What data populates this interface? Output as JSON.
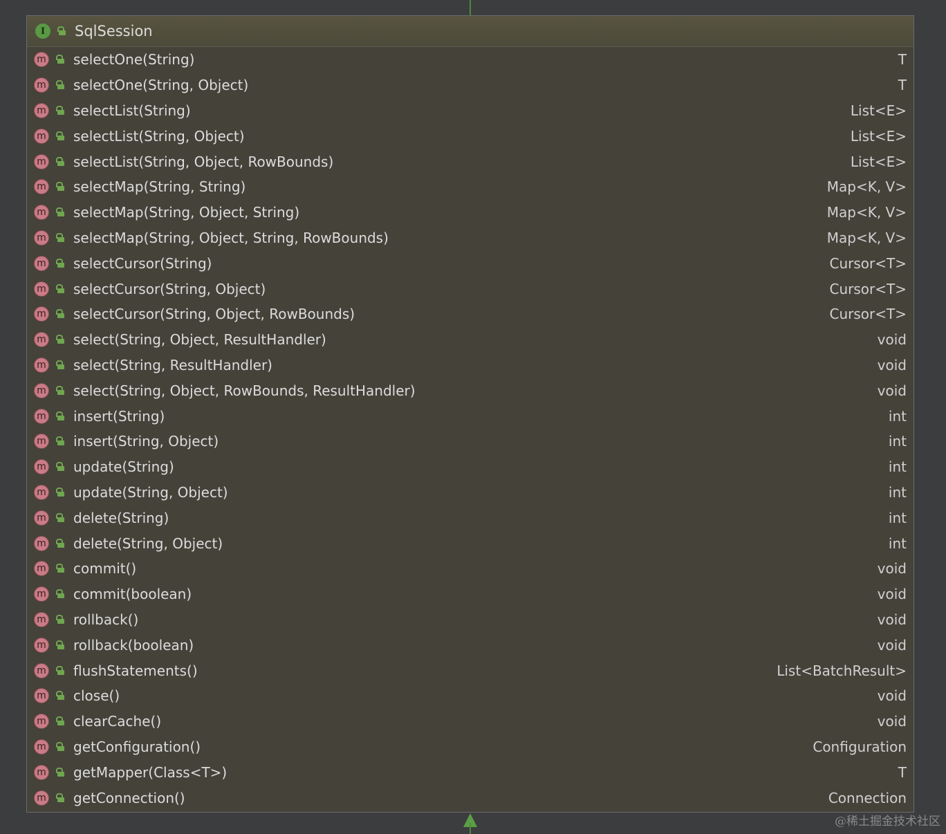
{
  "class": {
    "icon_letter": "I",
    "name": "SqlSession",
    "methods": [
      {
        "name": "selectOne(String)",
        "returns": "T"
      },
      {
        "name": "selectOne(String, Object)",
        "returns": "T"
      },
      {
        "name": "selectList(String)",
        "returns": "List<E>"
      },
      {
        "name": "selectList(String, Object)",
        "returns": "List<E>"
      },
      {
        "name": "selectList(String, Object, RowBounds)",
        "returns": "List<E>"
      },
      {
        "name": "selectMap(String, String)",
        "returns": "Map<K, V>"
      },
      {
        "name": "selectMap(String, Object, String)",
        "returns": "Map<K, V>"
      },
      {
        "name": "selectMap(String, Object, String, RowBounds)",
        "returns": "Map<K, V>"
      },
      {
        "name": "selectCursor(String)",
        "returns": "Cursor<T>"
      },
      {
        "name": "selectCursor(String, Object)",
        "returns": "Cursor<T>"
      },
      {
        "name": "selectCursor(String, Object, RowBounds)",
        "returns": "Cursor<T>"
      },
      {
        "name": "select(String, Object, ResultHandler)",
        "returns": "void"
      },
      {
        "name": "select(String, ResultHandler)",
        "returns": "void"
      },
      {
        "name": "select(String, Object, RowBounds, ResultHandler)",
        "returns": "void"
      },
      {
        "name": "insert(String)",
        "returns": "int"
      },
      {
        "name": "insert(String, Object)",
        "returns": "int"
      },
      {
        "name": "update(String)",
        "returns": "int"
      },
      {
        "name": "update(String, Object)",
        "returns": "int"
      },
      {
        "name": "delete(String)",
        "returns": "int"
      },
      {
        "name": "delete(String, Object)",
        "returns": "int"
      },
      {
        "name": "commit()",
        "returns": "void"
      },
      {
        "name": "commit(boolean)",
        "returns": "void"
      },
      {
        "name": "rollback()",
        "returns": "void"
      },
      {
        "name": "rollback(boolean)",
        "returns": "void"
      },
      {
        "name": "flushStatements()",
        "returns": "List<BatchResult>"
      },
      {
        "name": "close()",
        "returns": "void"
      },
      {
        "name": "clearCache()",
        "returns": "void"
      },
      {
        "name": "getConfiguration()",
        "returns": "Configuration"
      },
      {
        "name": "getMapper(Class<T>)",
        "returns": "T"
      },
      {
        "name": "getConnection()",
        "returns": "Connection"
      }
    ]
  },
  "method_icon_letter": "m",
  "watermark": "@稀土掘金技术社区",
  "colors": {
    "background": "#3b3d3f",
    "box_fill": "#45423a",
    "interface_icon": "#5a9a45",
    "method_icon": "#c97c86",
    "public_lock": "#6fa64f",
    "connector": "#5b9e45"
  }
}
